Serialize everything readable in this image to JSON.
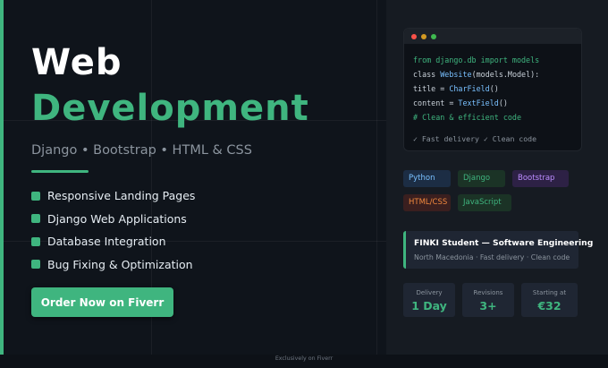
{
  "hero": {
    "title_line1": "Web",
    "title_line2": "Development",
    "subtitle": "Django • Bootstrap • HTML & CSS",
    "features": [
      "Responsive Landing Pages",
      "Django Web Applications",
      "Database Integration",
      "Bug Fixing & Optimization"
    ],
    "cta_label": "Order Now on Fiverr"
  },
  "code_window": {
    "line1": "from django.db import models",
    "line2_kw": "class ",
    "line2_fn": "Website",
    "line2_rest": "(models.Model):",
    "line3_a": "title = ",
    "line3_fn": "CharField",
    "line3_b": "()",
    "line4_a": "content = ",
    "line4_fn": "TextField",
    "line4_b": "()",
    "line5": "# Clean & efficient code",
    "footer": "✓ Fast delivery ✓ Clean code"
  },
  "tags": [
    "Python",
    "Django",
    "Bootstrap",
    "HTML/CSS",
    "JavaScript"
  ],
  "info_card": {
    "title": "FINKI Student — Software Engineering",
    "subtitle": "North Macedonia · Fast delivery · Clean code"
  },
  "stats": [
    {
      "label": "Delivery",
      "value": "1 Day"
    },
    {
      "label": "Revisions",
      "value": "3+"
    },
    {
      "label": "Starting at",
      "value": "€32"
    }
  ],
  "footer_text": "Exclusively on Fiverr",
  "colors": {
    "accent": "#3fb57f",
    "background": "#0d1117",
    "panel": "#161b22"
  }
}
